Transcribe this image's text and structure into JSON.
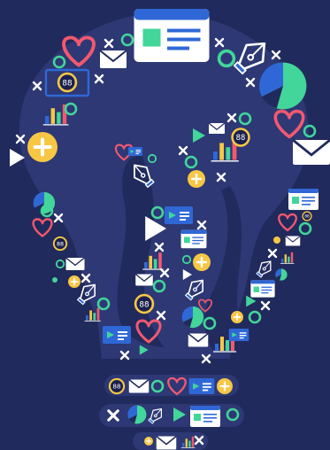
{
  "illustration": {
    "colors": {
      "background": "#212a5c",
      "bulb": "#2d3874",
      "green": "#42d69a",
      "red": "#f2596f",
      "yellow": "#f7c744",
      "blue": "#2f68d6",
      "white": "#ffffff",
      "navy": "#1a2150"
    },
    "badge_text": "88",
    "icons": [
      "browser-window-icon",
      "heart-icon",
      "close-icon",
      "ring-icon",
      "envelope-icon",
      "pen-nib-icon",
      "pie-chart-icon",
      "bar-chart-icon",
      "play-icon",
      "plus-icon",
      "badge-88-icon",
      "media-card-icon"
    ]
  }
}
